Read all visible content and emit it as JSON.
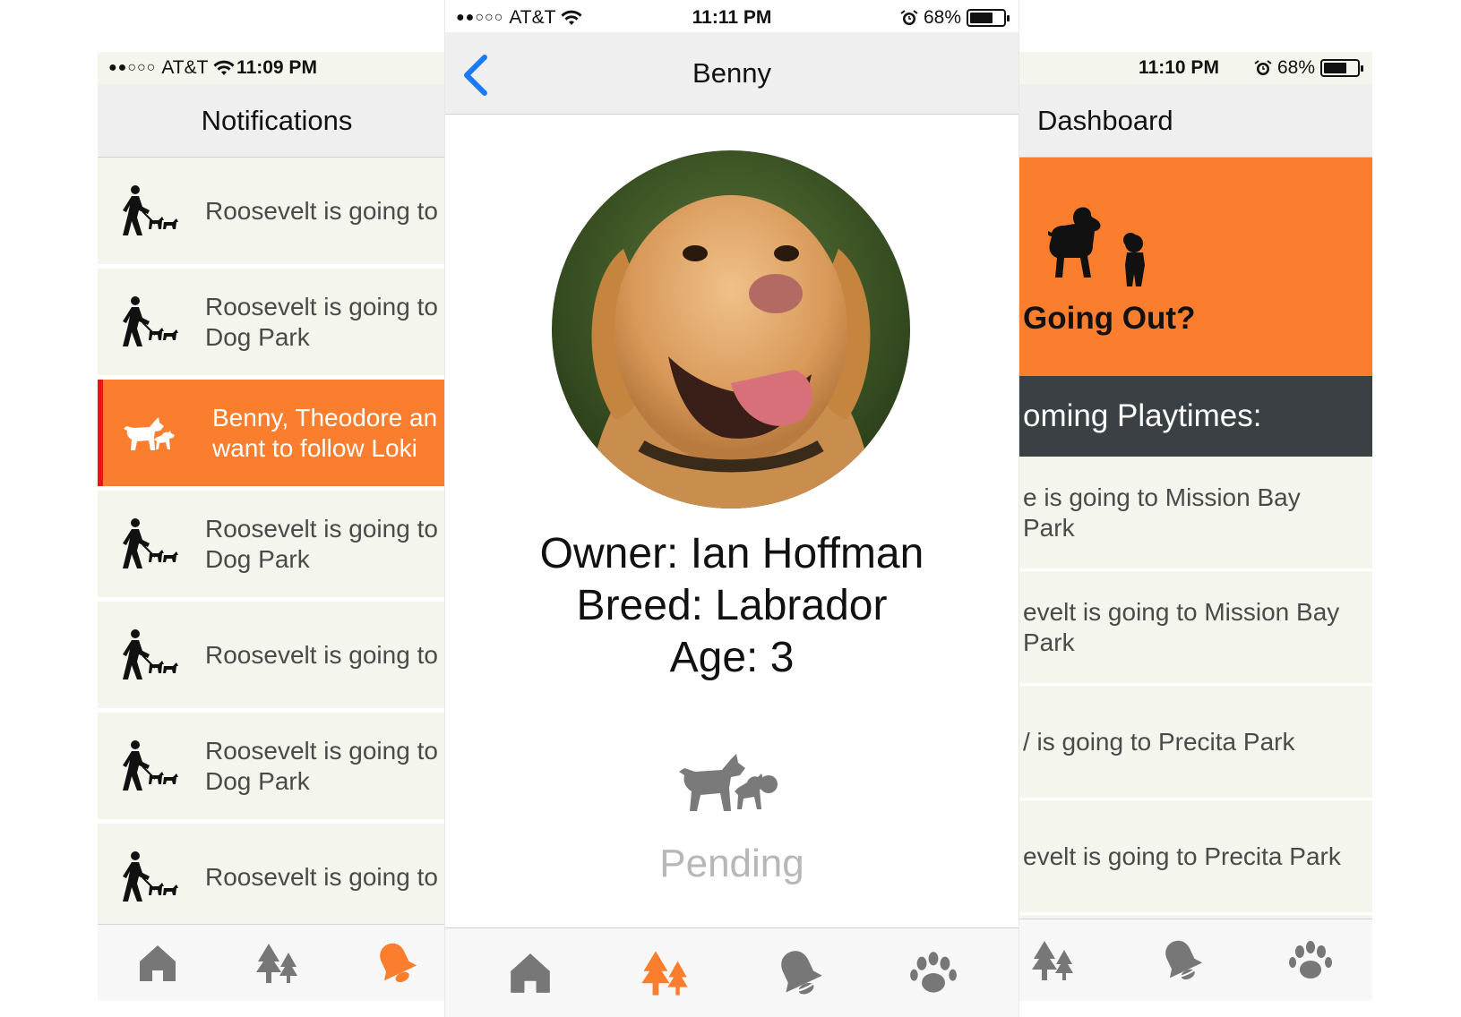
{
  "colors": {
    "accent": "#fb7e2e",
    "alert": "#e8141a",
    "dark_band": "#3b4044",
    "row_bg": "#f4f5ec",
    "icon_gray": "#777777",
    "ios_blue": "#1a7cf5",
    "pending_gray": "#b7b7b7"
  },
  "left": {
    "status": {
      "carrier": "AT&T",
      "time": "11:09 PM"
    },
    "title": "Notifications",
    "notifications": [
      {
        "text": "Roosevelt is going to",
        "icon": "dog-walker-icon"
      },
      {
        "text": "Roosevelt is going to\nDog Park",
        "icon": "dog-walker-icon"
      },
      {
        "text": "Benny, Theodore an\nwant to follow Loki",
        "icon": "dogs-icon",
        "active": true
      },
      {
        "text": "Roosevelt is going to\nDog Park",
        "icon": "dog-walker-icon"
      },
      {
        "text": "Roosevelt is going to",
        "icon": "dog-walker-icon"
      },
      {
        "text": "Roosevelt is going to\nDog Park",
        "icon": "dog-walker-icon"
      },
      {
        "text": "Roosevelt is going to",
        "icon": "dog-walker-icon"
      }
    ]
  },
  "center": {
    "status": {
      "carrier": "AT&T",
      "time": "11:11 PM",
      "battery": "68%"
    },
    "title": "Benny",
    "owner": "Owner: Ian Hoffman",
    "breed": "Breed: Labrador",
    "age": "Age: 3",
    "pending": "Pending",
    "tabs": [
      "home-icon",
      "trees-icon",
      "bell-icon",
      "paw-icon"
    ],
    "active_tab": "trees-icon"
  },
  "right": {
    "status": {
      "time": "11:10 PM",
      "battery": "68%"
    },
    "title": "Dashboard",
    "going_out": "Going Out?",
    "upcoming": "oming Playtimes:",
    "playtimes": [
      "e is going to Mission Bay\nPark",
      "evelt is going to Mission Bay\nPark",
      "/ is going to Precita Park",
      "evelt is going to Precita Park"
    ]
  }
}
